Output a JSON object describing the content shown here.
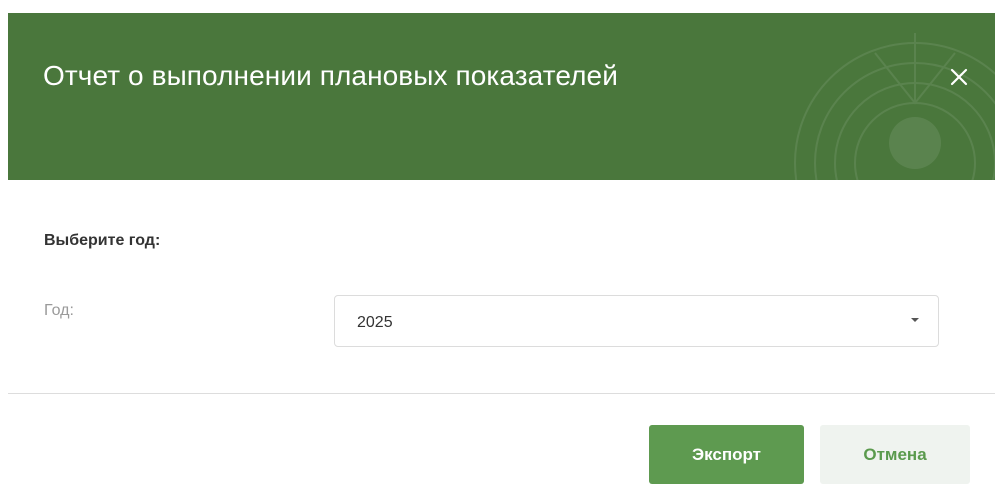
{
  "dialog": {
    "title": "Отчет о выполнении плановых показателей",
    "close_icon": "close-icon",
    "header_color": "#4a773c"
  },
  "form": {
    "section_label": "Выберите год:",
    "year_label": "Год:",
    "year_value": "2025",
    "year_dropdown_icon": "caret-down-icon"
  },
  "footer": {
    "export_label": "Экспорт",
    "cancel_label": "Отмена",
    "export_color": "#5e9a50"
  }
}
